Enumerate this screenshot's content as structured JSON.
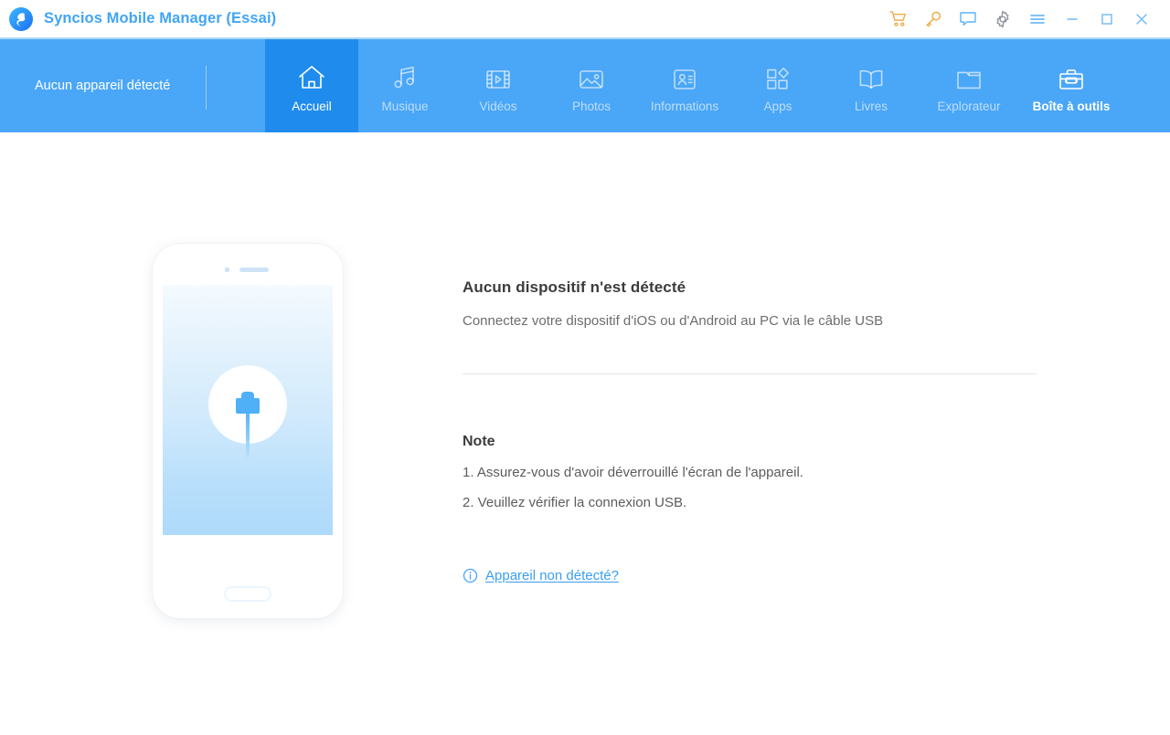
{
  "window": {
    "title": "Syncios Mobile Manager (Essai)",
    "logo_icon": "syncios-logo-icon",
    "title_color": "#41a5f5",
    "controls": [
      {
        "name": "cart-icon",
        "label": "Panier",
        "color": "#f0a63c"
      },
      {
        "name": "key-icon",
        "label": "Licence",
        "color": "#f0a63c"
      },
      {
        "name": "feedback-icon",
        "label": "Commentaires",
        "color": "#5cb3f7"
      },
      {
        "name": "gear-icon",
        "label": "Paramètres",
        "color": "#8b9199"
      },
      {
        "name": "menu-icon",
        "label": "Menu",
        "color": "#6fb9f4"
      },
      {
        "name": "minimize-button",
        "label": "Réduire",
        "color": "#6fb9f4"
      },
      {
        "name": "maximize-button",
        "label": "Agrandir",
        "color": "#6fb9f4"
      },
      {
        "name": "close-button",
        "label": "Fermer",
        "color": "#6fb9f4"
      }
    ]
  },
  "navbar": {
    "background": "#4aa6f7",
    "active_background": "#1f8ced",
    "device_status": "Aucun appareil détecté",
    "items": [
      {
        "label": "Accueil",
        "icon": "home-icon",
        "state": "active"
      },
      {
        "label": "Musique",
        "icon": "music-icon",
        "state": "normal"
      },
      {
        "label": "Vidéos",
        "icon": "video-icon",
        "state": "normal"
      },
      {
        "label": "Photos",
        "icon": "photo-icon",
        "state": "normal"
      },
      {
        "label": "Informations",
        "icon": "contact-icon",
        "state": "normal"
      },
      {
        "label": "Apps",
        "icon": "apps-icon",
        "state": "normal"
      },
      {
        "label": "Livres",
        "icon": "book-icon",
        "state": "normal"
      },
      {
        "label": "Explorateur",
        "icon": "folder-icon",
        "state": "normal"
      },
      {
        "label": "Boîte à outils",
        "icon": "toolbox-icon",
        "state": "highlight"
      }
    ]
  },
  "main": {
    "illustration": {
      "name": "phone-illustration",
      "screen_icon": "usb-plug-icon",
      "accent": "#4fb0f7"
    },
    "headline": "Aucun dispositif n'est détecté",
    "subline": "Connectez votre dispositif d'iOS ou d'Android au PC via le câble USB",
    "note": {
      "title": "Note",
      "lines": [
        "1. Assurez-vous d'avoir déverrouillé l'écran de l'appareil.",
        "2. Veuillez vérifier la connexion USB."
      ]
    },
    "help": {
      "icon": "info-circle-icon",
      "link_text": "Appareil non détecté?",
      "link_color": "#3a9ef0"
    }
  }
}
